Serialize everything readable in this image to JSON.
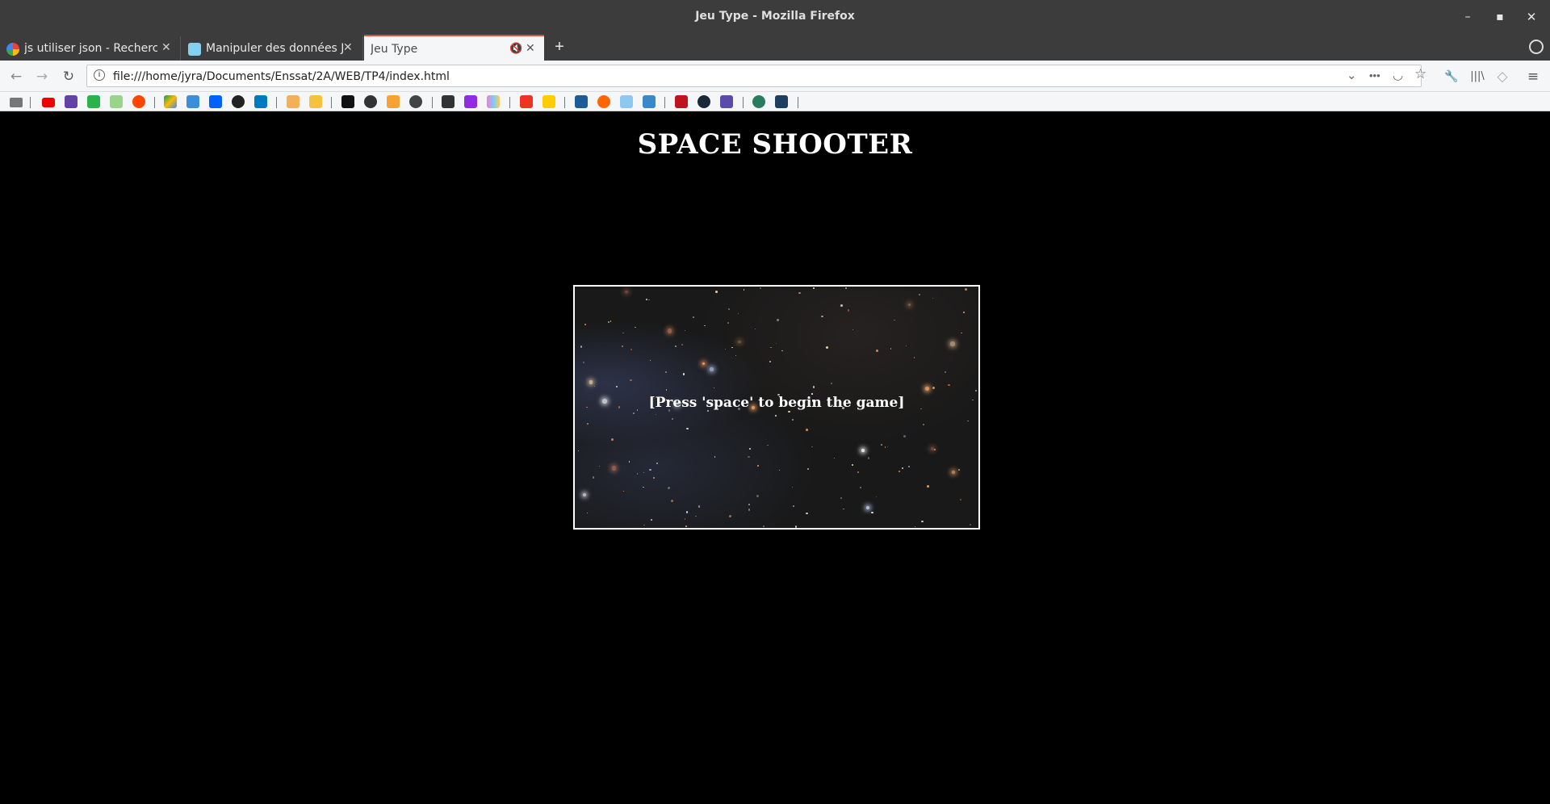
{
  "window": {
    "title": "Jeu Type - Mozilla Firefox",
    "controls": {
      "minimize": "–",
      "maximize": "▪",
      "close": "✕"
    }
  },
  "tabs": [
    {
      "label": "js utiliser json - Recherche",
      "favicon": "google-icon",
      "active": false
    },
    {
      "label": "Manipuler des données JSON",
      "favicon": "mdn-icon",
      "active": false
    },
    {
      "label": "Jeu Type",
      "favicon": "",
      "active": true
    }
  ],
  "new_tab_label": "+",
  "navbar": {
    "back": "←",
    "forward": "→",
    "reload": "↻",
    "url": "file:///home/jyra/Documents/Enssat/2A/WEB/TP4/index.html",
    "page_actions": "•••",
    "dropdown": "⌄",
    "pocket": "◡",
    "bookmark_star": "☆",
    "tools": "🔧",
    "library": "|||\\",
    "shield": "◇",
    "menu": "≡"
  },
  "bookmarks": [
    "folder-icon",
    "youtube-icon",
    "twitch-icon",
    "feedly-icon",
    "spreadsheet-icon",
    "reddit-icon",
    "drive-icon",
    "pocket-icon",
    "dropbox-icon",
    "github-icon",
    "trello-icon",
    "ifttt-icon",
    "note-icon",
    "m-icon",
    "circle-icon",
    "play-icon",
    "clock-icon",
    "link-icon",
    "d-icon",
    "bars-icon",
    "flash-icon",
    "mc-icon",
    "news-icon",
    "puzzle-icon",
    "book-icon",
    "hands-icon",
    "h-icon",
    "steam-icon",
    "video-icon",
    "check-icon",
    "terminal-icon"
  ],
  "page": {
    "title": "SPACE SHOOTER",
    "game_message": "[Press 'space' to begin the game]"
  },
  "colors": {
    "chrome_dark": "#3c3c3c",
    "toolbar": "#f5f6f7",
    "active_tab_accent": "#e74c3c",
    "page_bg": "#000000",
    "text_white": "#ffffff"
  }
}
